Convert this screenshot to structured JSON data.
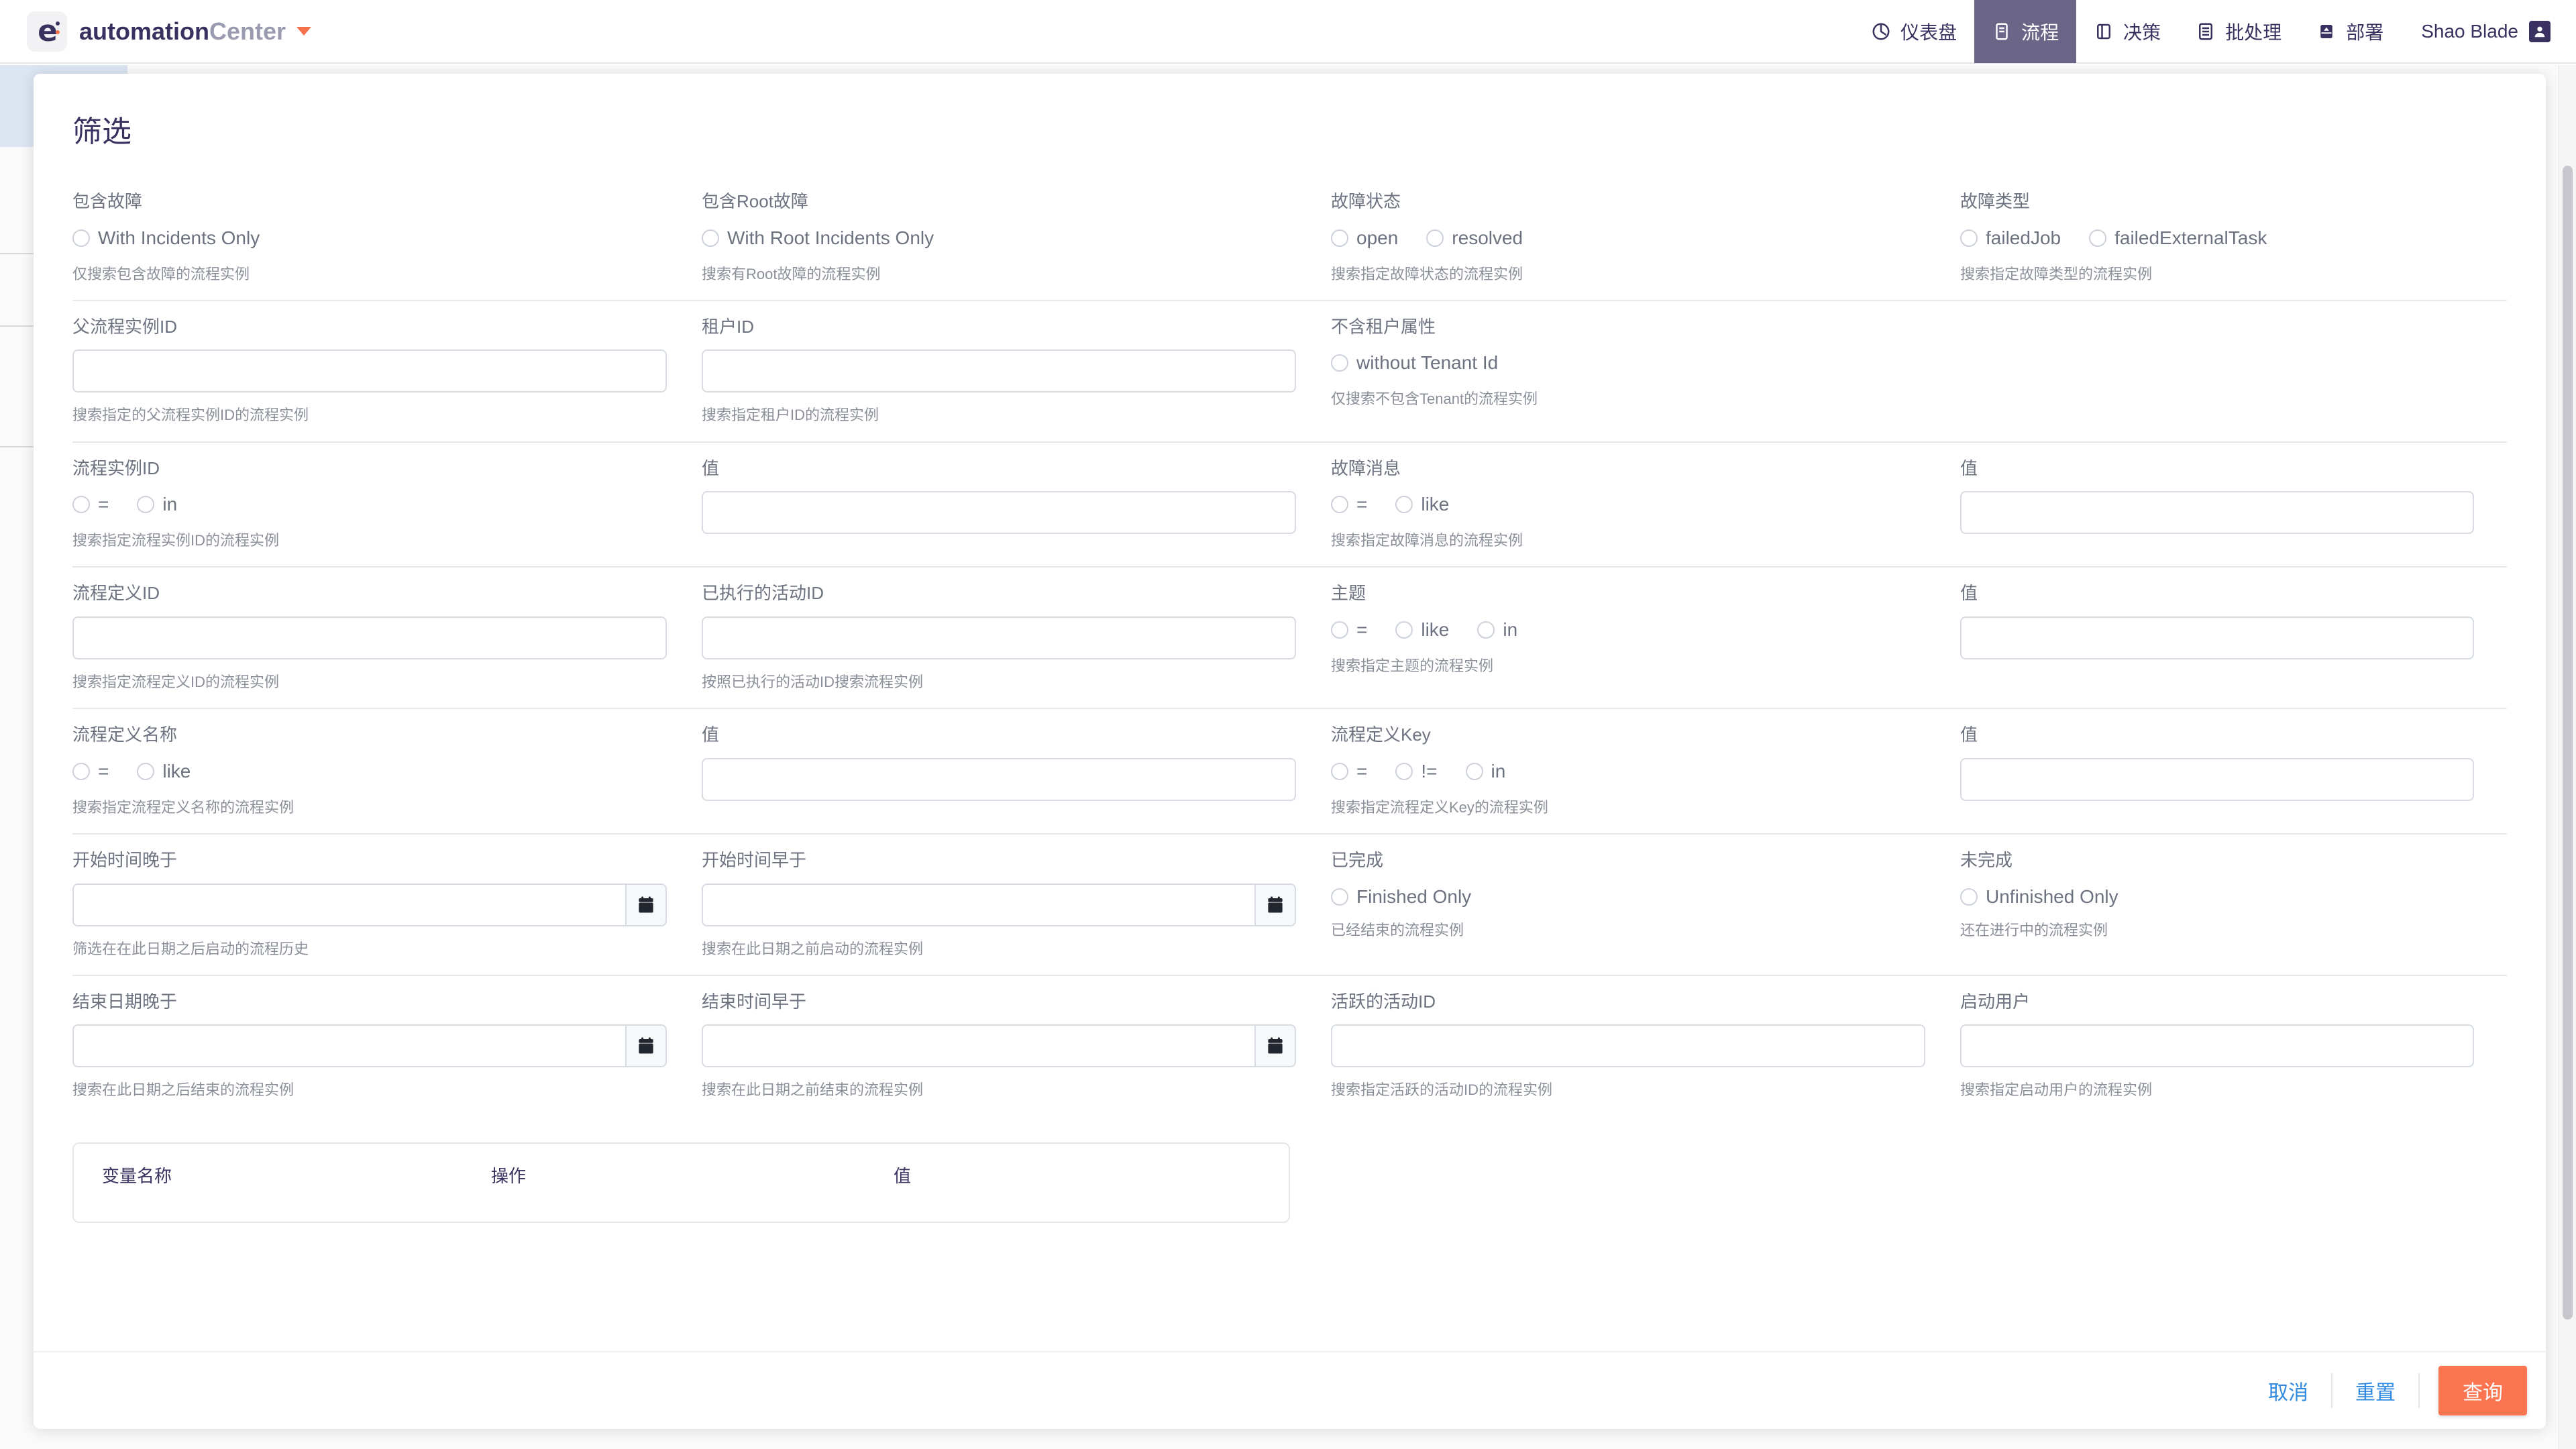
{
  "brand": {
    "logo_icon": "e-colon-logo-icon",
    "name_part1": "automation",
    "name_part2": "Center",
    "caret_icon": "chevron-down-icon"
  },
  "nav": {
    "items": [
      {
        "label": "仪表盘",
        "icon": "dashboard-icon",
        "active": false
      },
      {
        "label": "流程",
        "icon": "process-icon",
        "active": true
      },
      {
        "label": "决策",
        "icon": "decision-icon",
        "active": false
      },
      {
        "label": "批处理",
        "icon": "batch-icon",
        "active": false
      },
      {
        "label": "部署",
        "icon": "deploy-icon",
        "active": false
      }
    ],
    "user": {
      "name": "Shao Blade",
      "icon": "user-avatar-icon"
    }
  },
  "modal": {
    "title": "筛选",
    "rows": [
      {
        "cells": [
          {
            "label": "包含故障",
            "type": "radios",
            "options": [
              {
                "text": "With Incidents Only"
              }
            ],
            "hint": "仅搜索包含故障的流程实例"
          },
          {
            "label": "包含Root故障",
            "type": "radios",
            "options": [
              {
                "text": "With Root Incidents Only"
              }
            ],
            "hint": "搜索有Root故障的流程实例"
          },
          {
            "label": "故障状态",
            "type": "radios",
            "options": [
              {
                "text": "open"
              },
              {
                "text": "resolved"
              }
            ],
            "hint": "搜索指定故障状态的流程实例"
          },
          {
            "label": "故障类型",
            "type": "radios",
            "options": [
              {
                "text": "failedJob"
              },
              {
                "text": "failedExternalTask"
              }
            ],
            "hint": "搜索指定故障类型的流程实例"
          }
        ]
      },
      {
        "cells": [
          {
            "label": "父流程实例ID",
            "type": "input",
            "value": "",
            "hint": "搜索指定的父流程实例ID的流程实例"
          },
          {
            "label": "租户ID",
            "type": "input",
            "value": "",
            "hint": "搜索指定租户ID的流程实例"
          },
          {
            "label": "不含租户属性",
            "type": "radios",
            "options": [
              {
                "text": "without Tenant Id"
              }
            ],
            "hint": "仅搜索不包含Tenant的流程实例"
          },
          {
            "label": "",
            "type": "empty",
            "hint": ""
          }
        ]
      },
      {
        "cells": [
          {
            "label": "流程实例ID",
            "type": "radios",
            "options": [
              {
                "text": "="
              },
              {
                "text": "in"
              }
            ],
            "hint": "搜索指定流程实例ID的流程实例"
          },
          {
            "label": "值",
            "type": "input",
            "value": "",
            "hint": ""
          },
          {
            "label": "故障消息",
            "type": "radios",
            "options": [
              {
                "text": "="
              },
              {
                "text": "like"
              }
            ],
            "hint": "搜索指定故障消息的流程实例"
          },
          {
            "label": "值",
            "type": "input",
            "value": "",
            "hint": ""
          }
        ]
      },
      {
        "cells": [
          {
            "label": "流程定义ID",
            "type": "input",
            "value": "",
            "hint": "搜索指定流程定义ID的流程实例"
          },
          {
            "label": "已执行的活动ID",
            "type": "input",
            "value": "",
            "hint": "按照已执行的活动ID搜索流程实例"
          },
          {
            "label": "主题",
            "type": "radios",
            "options": [
              {
                "text": "="
              },
              {
                "text": "like"
              },
              {
                "text": "in"
              }
            ],
            "hint": "搜索指定主题的流程实例"
          },
          {
            "label": "值",
            "type": "input",
            "value": "",
            "hint": ""
          }
        ]
      },
      {
        "cells": [
          {
            "label": "流程定义名称",
            "type": "radios",
            "options": [
              {
                "text": "="
              },
              {
                "text": "like"
              }
            ],
            "hint": "搜索指定流程定义名称的流程实例"
          },
          {
            "label": "值",
            "type": "input",
            "value": "",
            "hint": ""
          },
          {
            "label": "流程定义Key",
            "type": "radios",
            "options": [
              {
                "text": "="
              },
              {
                "text": "!="
              },
              {
                "text": "in"
              }
            ],
            "hint": "搜索指定流程定义Key的流程实例"
          },
          {
            "label": "值",
            "type": "input",
            "value": "",
            "hint": ""
          }
        ]
      },
      {
        "cells": [
          {
            "label": "开始时间晚于",
            "type": "date",
            "value": "",
            "icon": "calendar-icon",
            "hint": "筛选在在此日期之后启动的流程历史"
          },
          {
            "label": "开始时间早于",
            "type": "date",
            "value": "",
            "icon": "calendar-icon",
            "hint": "搜索在此日期之前启动的流程实例"
          },
          {
            "label": "已完成",
            "type": "radios",
            "options": [
              {
                "text": "Finished Only"
              }
            ],
            "hint": "已经结束的流程实例"
          },
          {
            "label": "未完成",
            "type": "radios",
            "options": [
              {
                "text": "Unfinished Only"
              }
            ],
            "hint": "还在进行中的流程实例"
          }
        ]
      },
      {
        "cells": [
          {
            "label": "结束日期晚于",
            "type": "date",
            "value": "",
            "icon": "calendar-icon",
            "hint": "搜索在此日期之后结束的流程实例"
          },
          {
            "label": "结束时间早于",
            "type": "date",
            "value": "",
            "icon": "calendar-icon",
            "hint": "搜索在此日期之前结束的流程实例"
          },
          {
            "label": "活跃的活动ID",
            "type": "input",
            "value": "",
            "hint": "搜索指定活跃的活动ID的流程实例"
          },
          {
            "label": "启动用户",
            "type": "input",
            "value": "",
            "hint": "搜索指定启动用户的流程实例"
          }
        ]
      }
    ],
    "variables_table": {
      "columns": [
        "变量名称",
        "操作",
        "值"
      ]
    },
    "footer": {
      "cancel": "取消",
      "reset": "重置",
      "query": "查询",
      "primary_color": "#fb7551",
      "link_color": "#2f8ae0"
    }
  }
}
